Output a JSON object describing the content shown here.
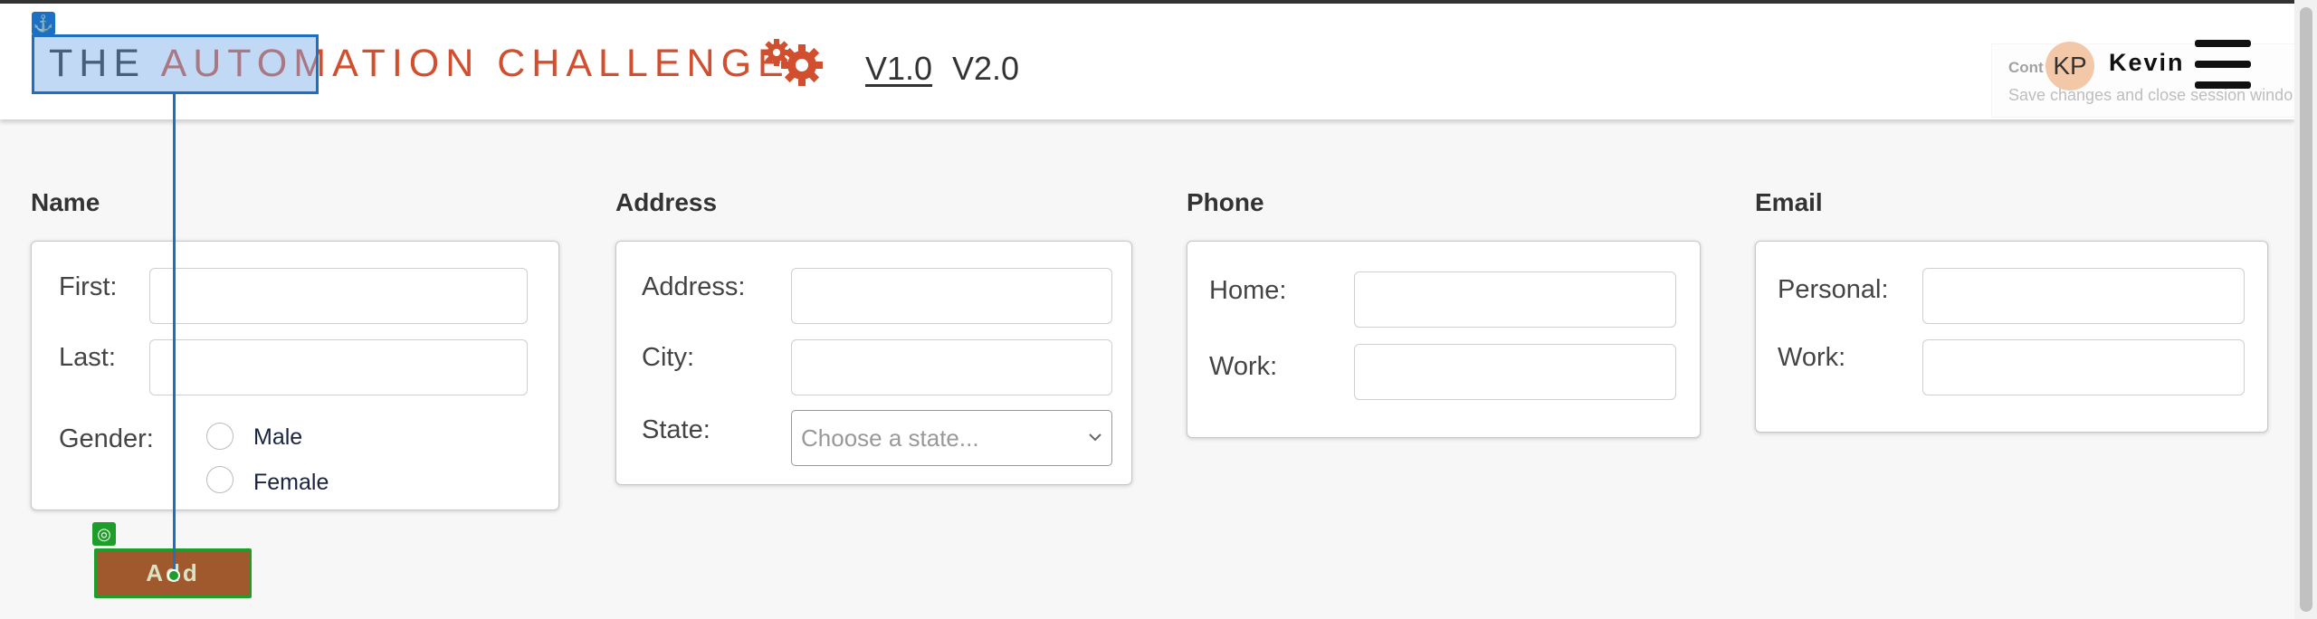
{
  "header": {
    "brand_prefix": "THE",
    "brand_main": "AUTOMATION CHALLENGE",
    "nav_links": [
      {
        "label": "V1.0",
        "active": true
      },
      {
        "label": "V2.0",
        "active": false
      }
    ],
    "toast": {
      "title": "Cont",
      "message": "Save changes and close session  windo"
    },
    "user": {
      "initials": "KP",
      "name": "Kevin"
    },
    "icons": {
      "gears": "gears-icon",
      "menu": "hamburger-menu-icon"
    }
  },
  "sections": {
    "name": {
      "title": "Name",
      "first_label": "First:",
      "first_value": "",
      "last_label": "Last:",
      "last_value": "",
      "gender_label": "Gender:",
      "gender_options": [
        "Male",
        "Female"
      ]
    },
    "address": {
      "title": "Address",
      "address_label": "Address:",
      "address_value": "",
      "city_label": "City:",
      "city_value": "",
      "state_label": "State:",
      "state_placeholder": "Choose a state..."
    },
    "phone": {
      "title": "Phone",
      "home_label": "Home:",
      "home_value": "",
      "work_label": "Work:",
      "work_value": ""
    },
    "email": {
      "title": "Email",
      "personal_label": "Personal:",
      "personal_value": "",
      "work_label": "Work:",
      "work_value": ""
    }
  },
  "actions": {
    "add_label": "Add"
  },
  "overlay": {
    "anchor_icon": "⚓",
    "target_icon": "◎"
  },
  "colors": {
    "brand": "#d14f2e",
    "button_bg": "#a0582d",
    "highlight_blue": "#1d6fc4",
    "target_green": "#1f9d2a",
    "avatar_bg": "#f3c8a8"
  }
}
